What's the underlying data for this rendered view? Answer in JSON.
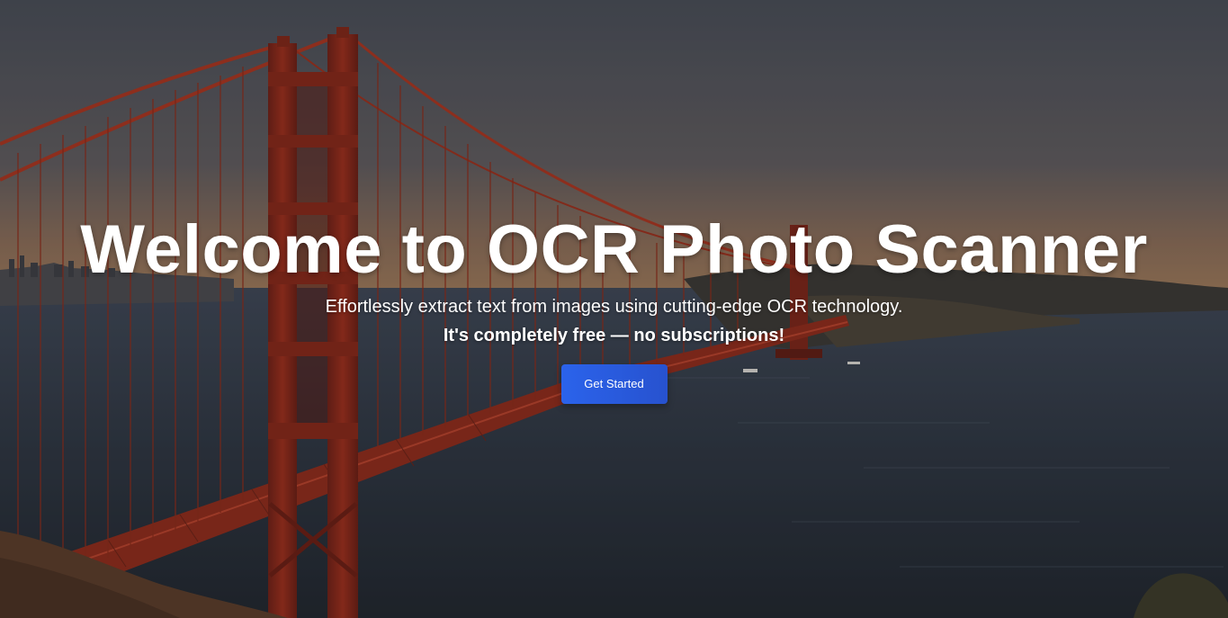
{
  "hero": {
    "title": "Welcome to OCR Photo Scanner",
    "subtitle": "Effortlessly extract text from images using cutting-edge OCR technology.",
    "tagline": "It's completely free — no subscriptions!",
    "cta_label": "Get Started"
  },
  "colors": {
    "cta": "#2b63eb",
    "text": "#ffffff",
    "bridge": "#9a2a18"
  }
}
